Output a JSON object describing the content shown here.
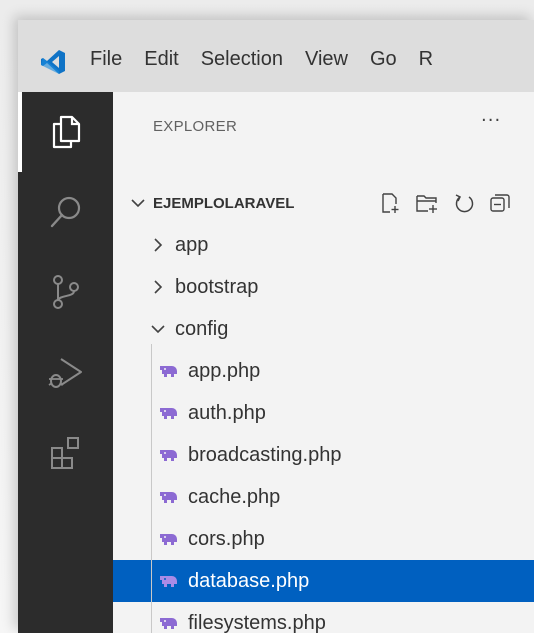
{
  "menu": {
    "items": [
      "File",
      "Edit",
      "Selection",
      "View",
      "Go",
      "R"
    ]
  },
  "explorer": {
    "title": "EXPLORER",
    "more": "···",
    "root": "EJEMPLOLARAVEL",
    "folders": [
      {
        "name": "app",
        "expanded": false
      },
      {
        "name": "bootstrap",
        "expanded": false
      },
      {
        "name": "config",
        "expanded": true
      }
    ],
    "files": [
      {
        "name": "app.php"
      },
      {
        "name": "auth.php"
      },
      {
        "name": "broadcasting.php"
      },
      {
        "name": "cache.php"
      },
      {
        "name": "cors.php"
      },
      {
        "name": "database.php",
        "selected": true
      },
      {
        "name": "filesystems.php"
      }
    ]
  },
  "colors": {
    "selection": "#0060c0",
    "activitybar": "#2c2c2c",
    "php_icon": "#8c6ad3",
    "vscode_blue": "#0f73c6"
  }
}
